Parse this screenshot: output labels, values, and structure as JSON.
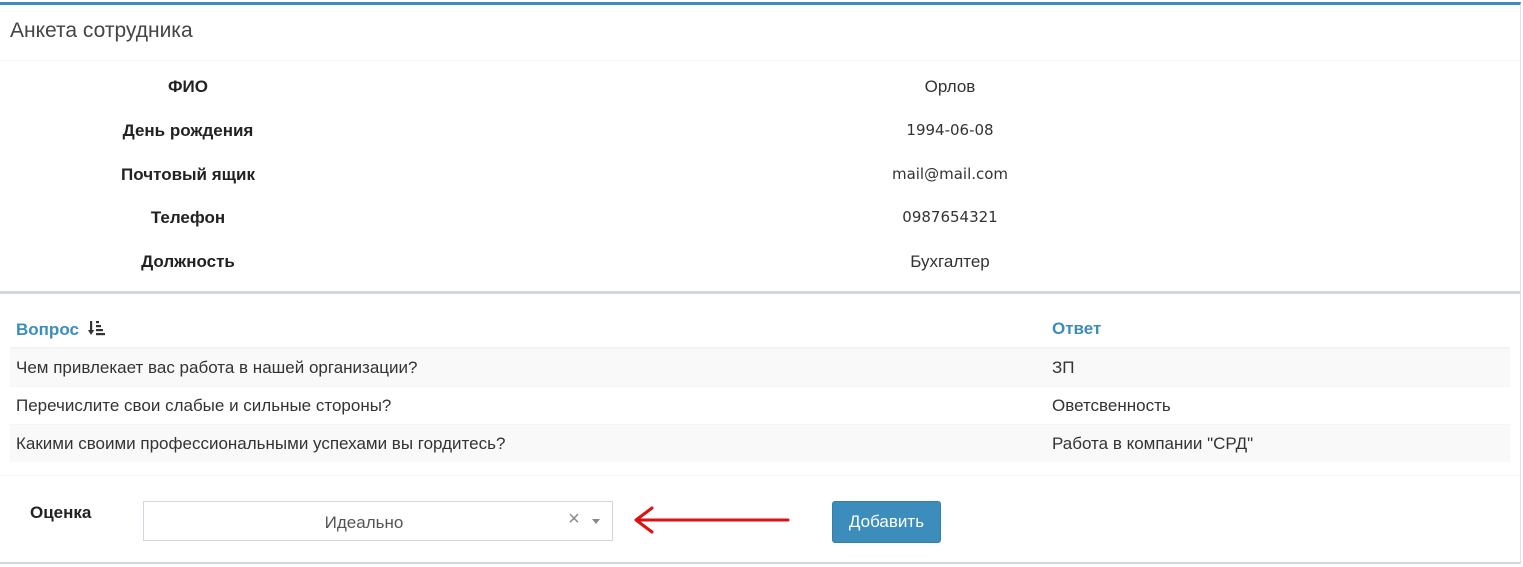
{
  "panel": {
    "title": "Анкета сотрудника"
  },
  "profile": [
    {
      "label": "ФИО",
      "value": "Орлов"
    },
    {
      "label": "День рождения",
      "value": "1994-06-08"
    },
    {
      "label": "Почтовый ящик",
      "value": "mail@mail.com"
    },
    {
      "label": "Телефон",
      "value": "0987654321"
    },
    {
      "label": "Должность",
      "value": "Бухгалтер"
    }
  ],
  "qa": {
    "headers": {
      "question": "Вопрос",
      "answer": "Ответ"
    },
    "sort_icon": "sort-amount-desc-icon",
    "rows": [
      {
        "question": "Чем привлекает вас работа в нашей организации?",
        "answer": "ЗП"
      },
      {
        "question": "Перечислите свои слабые и сильные стороны?",
        "answer": "Оветсвенность"
      },
      {
        "question": "Какими своими профессиональными успехами вы гордитесь?",
        "answer": "Работа в компании \"СРД\""
      }
    ]
  },
  "rating": {
    "label": "Оценка",
    "selected": "Идеально",
    "clear_icon": "×"
  },
  "actions": {
    "add_label": "Добавить"
  },
  "colors": {
    "accent": "#3c8dbc",
    "annotation_arrow": "#dd1111"
  }
}
